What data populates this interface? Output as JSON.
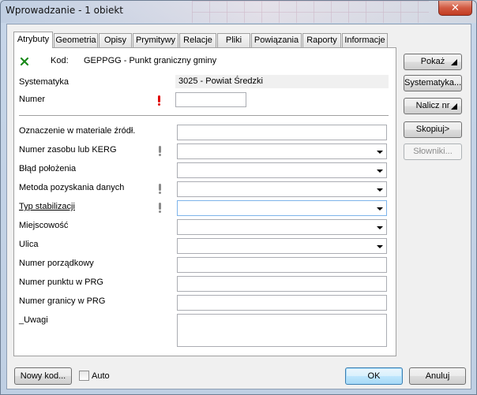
{
  "window": {
    "title": "Wprowadzanie - 1 obiekt",
    "close_symbol": "✕"
  },
  "tabs": [
    "Atrybuty",
    "Geometria",
    "Opisy",
    "Prymitywy",
    "Relacje",
    "Pliki",
    "Powiązania",
    "Raporty",
    "Informacje"
  ],
  "header": {
    "kod_label": "Kod:",
    "kod_value": "GEPPGG - Punkt graniczny gminy",
    "status_icon": "x-mark-icon",
    "status_color": "#1a8a1a"
  },
  "fields": {
    "systematyka": {
      "label": "Systematyka",
      "value": "3025 - Powiat Średzki"
    },
    "numer": {
      "label": "Numer",
      "value": ""
    },
    "oznaczenie": {
      "label": "Oznaczenie w materiale źródł.",
      "value": ""
    },
    "zasob": {
      "label": "Numer zasobu lub KERG",
      "value": ""
    },
    "blad": {
      "label": "Błąd położenia",
      "value": ""
    },
    "metoda": {
      "label": "Metoda pozyskania danych",
      "value": ""
    },
    "typ": {
      "label": "Typ stabilizacji",
      "value": ""
    },
    "miejscowosc": {
      "label": "Miejscowość",
      "value": ""
    },
    "ulica": {
      "label": "Ulica",
      "value": ""
    },
    "porzadkowy": {
      "label": "Numer porządkowy",
      "value": ""
    },
    "punkt_prg": {
      "label": "Numer punktu w PRG",
      "value": ""
    },
    "granica_prg": {
      "label": "Numer granicy w PRG",
      "value": ""
    },
    "uwagi": {
      "label": "_Uwagi",
      "value": ""
    }
  },
  "side_buttons": {
    "pokaz": "Pokaż",
    "systematyka": "Systematyka...",
    "nalicz": "Nalicz nr",
    "skopiuj": "Skopiuj>",
    "slowniki": "Słowniki..."
  },
  "footer": {
    "nowy_kod": "Nowy kod...",
    "auto": "Auto",
    "ok": "OK",
    "anuluj": "Anuluj"
  }
}
